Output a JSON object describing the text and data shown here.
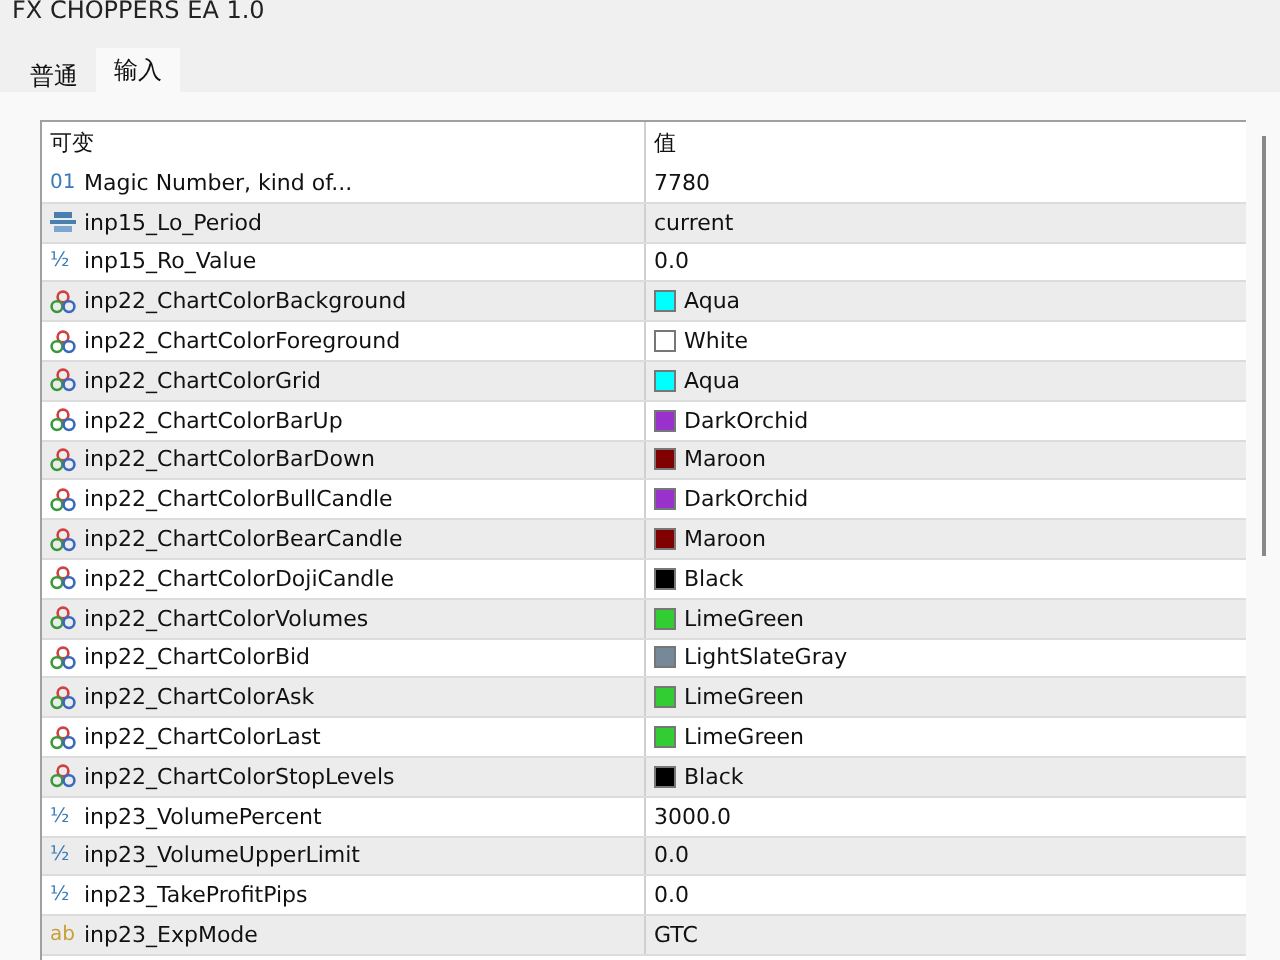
{
  "window": {
    "title": "FX CHOPPERS  EA 1.0"
  },
  "tabs": [
    {
      "label": "普通",
      "selected": false
    },
    {
      "label": "输入",
      "selected": true
    }
  ],
  "table": {
    "columns": [
      "可变",
      "值"
    ],
    "rows": [
      {
        "kind": "int",
        "icon": "01",
        "name": "Magic Number, kind of...",
        "value": "7780"
      },
      {
        "kind": "enum",
        "name": "inp15_Lo_Period",
        "value": "current"
      },
      {
        "kind": "double",
        "icon": "½",
        "name": "inp15_Ro_Value",
        "value": "0.0"
      },
      {
        "kind": "color",
        "name": "inp22_ChartColorBackground",
        "value": "Aqua",
        "color": "#00ffff"
      },
      {
        "kind": "color",
        "name": "inp22_ChartColorForeground",
        "value": "White",
        "color": "#ffffff"
      },
      {
        "kind": "color",
        "name": "inp22_ChartColorGrid",
        "value": "Aqua",
        "color": "#00ffff"
      },
      {
        "kind": "color",
        "name": "inp22_ChartColorBarUp",
        "value": "DarkOrchid",
        "color": "#9932cc"
      },
      {
        "kind": "color",
        "name": "inp22_ChartColorBarDown",
        "value": "Maroon",
        "color": "#800000"
      },
      {
        "kind": "color",
        "name": "inp22_ChartColorBullCandle",
        "value": "DarkOrchid",
        "color": "#9932cc"
      },
      {
        "kind": "color",
        "name": "inp22_ChartColorBearCandle",
        "value": "Maroon",
        "color": "#800000"
      },
      {
        "kind": "color",
        "name": "inp22_ChartColorDojiCandle",
        "value": "Black",
        "color": "#000000"
      },
      {
        "kind": "color",
        "name": "inp22_ChartColorVolumes",
        "value": "LimeGreen",
        "color": "#32cd32"
      },
      {
        "kind": "color",
        "name": "inp22_ChartColorBid",
        "value": "LightSlateGray",
        "color": "#778899"
      },
      {
        "kind": "color",
        "name": "inp22_ChartColorAsk",
        "value": "LimeGreen",
        "color": "#32cd32"
      },
      {
        "kind": "color",
        "name": "inp22_ChartColorLast",
        "value": "LimeGreen",
        "color": "#32cd32"
      },
      {
        "kind": "color",
        "name": "inp22_ChartColorStopLevels",
        "value": "Black",
        "color": "#000000"
      },
      {
        "kind": "double",
        "icon": "½",
        "name": "inp23_VolumePercent",
        "value": "3000.0"
      },
      {
        "kind": "double",
        "icon": "½",
        "name": "inp23_VolumeUpperLimit",
        "value": "0.0"
      },
      {
        "kind": "double",
        "icon": "½",
        "name": "inp23_TakeProfitPips",
        "value": "0.0"
      },
      {
        "kind": "string",
        "icon": "ab",
        "name": "inp23_ExpMode",
        "value": "GTC"
      }
    ]
  }
}
